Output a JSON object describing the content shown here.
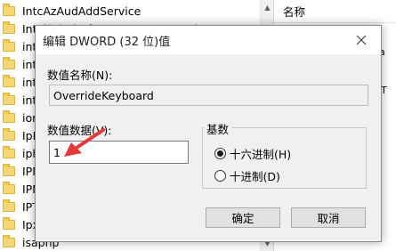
{
  "tree": {
    "items": [
      {
        "label": "IntcAzAudAddService"
      },
      {
        "label": "Intel(R) Platform Manager Service"
      },
      {
        "label": "intel"
      },
      {
        "label": "intel"
      },
      {
        "label": "intel"
      },
      {
        "label": "intel"
      },
      {
        "label": "iorate"
      },
      {
        "label": "IpFilter"
      },
      {
        "label": "iphlpsvc"
      },
      {
        "label": "IPMI"
      },
      {
        "label": "IPNAT"
      },
      {
        "label": "IPT"
      },
      {
        "label": "Ipxlat"
      },
      {
        "label": "isapnp"
      }
    ]
  },
  "right_pane": {
    "column_header": "名称",
    "fragments": [
      "a",
      "T"
    ]
  },
  "dialog": {
    "title": "编辑 DWORD (32 位)值",
    "value_name_label": "数值名称(N):",
    "value_name": "OverrideKeyboard",
    "value_data_label": "数值数据(V):",
    "value_data": "1",
    "base": {
      "legend": "基数",
      "options": [
        {
          "label": "十六进制(H)",
          "selected": true
        },
        {
          "label": "十进制(D)",
          "selected": false
        }
      ]
    },
    "ok_label": "确定",
    "cancel_label": "取消"
  },
  "colors": {
    "annotation_arrow": "#e53935",
    "folder": "#f7d774"
  }
}
